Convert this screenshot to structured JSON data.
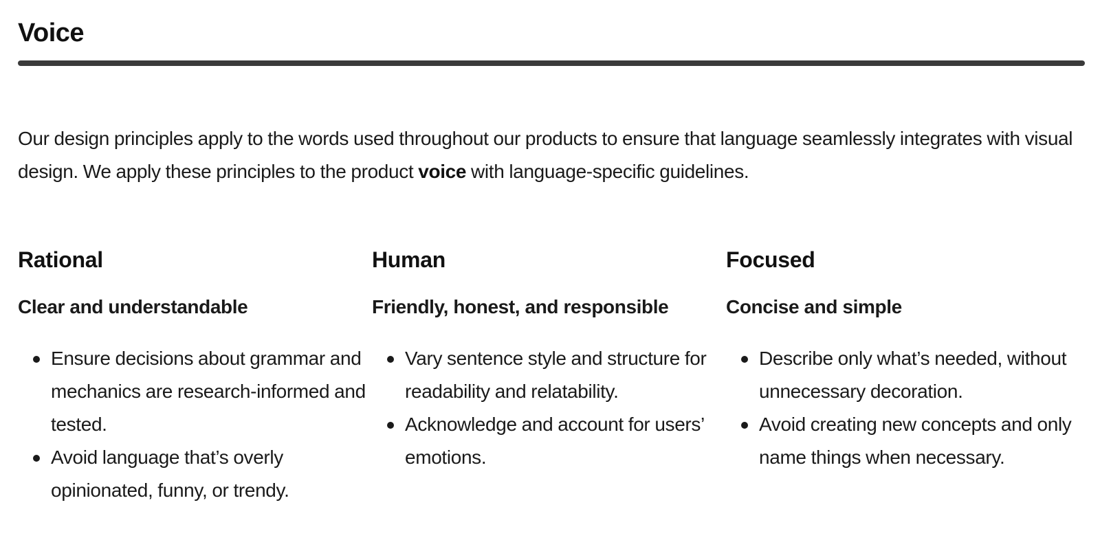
{
  "page": {
    "title": "Voice",
    "intro": {
      "before": "Our design principles apply to the words used throughout our products to ensure that language seamlessly integrates with visual design. We apply these principles to the product ",
      "emphasis": "voice",
      "after": " with language-specific guidelines."
    },
    "columns": [
      {
        "title": "Rational",
        "subtitle": "Clear and understandable",
        "items": [
          "Ensure decisions about grammar and mechanics are research-informed and tested.",
          "Avoid language that’s overly opinionated, funny, or trendy."
        ]
      },
      {
        "title": "Human",
        "subtitle": "Friendly, honest, and responsible",
        "items": [
          "Vary sentence style and structure for readability and relatability.",
          "Acknowledge and account for users’ emotions."
        ]
      },
      {
        "title": "Focused",
        "subtitle": "Concise and simple",
        "items": [
          "Describe only what’s needed, without unnecessary decoration.",
          "Avoid creating new concepts and only name things when necessary."
        ]
      }
    ]
  },
  "colors": {
    "text": "#1a1a1a",
    "heading": "#111111",
    "divider": "#3a3a3a",
    "background": "#ffffff"
  }
}
